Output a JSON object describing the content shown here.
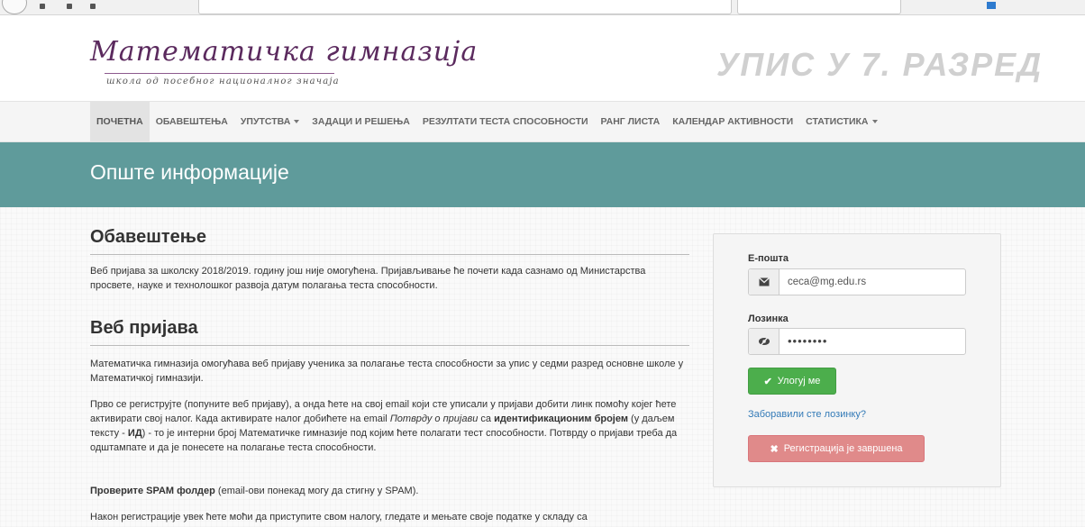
{
  "header": {
    "logo_script": "Математичка гимназија",
    "logo_sub": "школа од посебног националног значаја",
    "enroll_title": "УПИС У 7. РАЗРЕД"
  },
  "nav": {
    "items": [
      {
        "label": "ПОЧЕТНА",
        "active": true
      },
      {
        "label": "ОБАВЕШТЕЊА"
      },
      {
        "label": "УПУТСТВА",
        "dropdown": true
      },
      {
        "label": "ЗАДАЦИ И РЕШЕЊА"
      },
      {
        "label": "РЕЗУЛТАТИ ТЕСТА СПОСОБНОСТИ"
      },
      {
        "label": "РАНГ ЛИСТА"
      },
      {
        "label": "КАЛЕНДАР АКТИВНОСТИ"
      },
      {
        "label": "СТАТИСТИКА",
        "dropdown": true
      }
    ]
  },
  "banner": {
    "title": "Опште информације"
  },
  "notice": {
    "heading": "Обавештење",
    "text": "Веб пријава за школску 2018/2019. годину још није омогућена. Пријављивање ће почети када сазнамо од Министарства просвете, науке и технолошког развоја датум полагања теста способности."
  },
  "web": {
    "heading": "Веб пријава",
    "p1": "Математичка гимназија омогућава веб пријаву ученика за полагање теста способности за упис у седми разред основне школе у Математичкој гимназији.",
    "p2_a": "Прво се региструјте (попуните веб пријаву), а онда ћете на свој email који сте уписали у пријави добити линк помоћу којег ћете активирати свој налог. Када активирате налог добићете на email ",
    "p2_em": "Потврду о пријави",
    "p2_b": " са ",
    "p2_strong": "идентификационим бројем",
    "p2_c": " (у даљем тексту - ",
    "p2_id": "ИД",
    "p2_d": ") - то је интерни број Математичке гимназије под којим ћете полагати тест способности. Потврду о пријави треба да одштампате и да је понесете на полагање теста способности.",
    "p3_strong": "Проверите SPAM фолдер",
    "p3_rest": " (email-ови понекад могу да стигну у SPAM).",
    "p4": "Након регистрације увек ћете моћи да приступите свом налогу, гледате и мењате своје податке у складу са"
  },
  "login": {
    "email_label": "Е-пошта",
    "email_value": "ceca@mg.edu.rs",
    "email_icon": "envelope-icon",
    "password_label": "Лозинка",
    "password_value": "••••••••",
    "password_icon": "eye-slash-icon",
    "login_button": "Улогуј ме",
    "forgot_link": "Заборавили сте лозинку?",
    "register_button": "Регистрација је завршена",
    "colors": {
      "success": "#4cae4c",
      "danger": "#e08a8a",
      "link": "#337ab7",
      "banner": "#5f9b9b"
    }
  }
}
